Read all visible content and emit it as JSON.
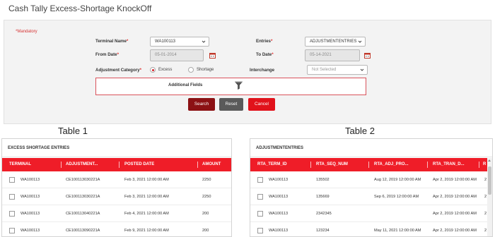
{
  "page": {
    "title": "Cash Tally Excess-Shortage KnockOff"
  },
  "form": {
    "mandatory": "*Mandatory",
    "terminal_name": {
      "label": "Terminal Name",
      "value": "WA100113"
    },
    "entries": {
      "label": "Entries",
      "value": "ADJUSTMENTENTRIES"
    },
    "from_date": {
      "label": "From Date",
      "value": "05-01-2014"
    },
    "to_date": {
      "label": "To Date",
      "value": "05-14-2021"
    },
    "adjustment_category": {
      "label": "Adjustment Category",
      "options": [
        "Excess",
        "Shortage"
      ],
      "selected": "Excess"
    },
    "interchange": {
      "label": "Interchange",
      "value": "Not Selected"
    },
    "additional_fields": "Additional Fields",
    "buttons": {
      "search": "Search",
      "reset": "Reset",
      "cancel": "Cancel"
    }
  },
  "captions": {
    "table1": "Table 1",
    "table2": "Table 2"
  },
  "table1": {
    "title": "EXCESS SHORTAGE ENTRIES",
    "columns": [
      "TERMINAL",
      "ADJUSTMENT...",
      "POSTED DATE",
      "AMOUNT"
    ],
    "rows": [
      [
        "WA100113",
        "CE100113030221A",
        "Feb 3, 2021 12:00:00 AM",
        "2250"
      ],
      [
        "WA100113",
        "CE100113030221A",
        "Feb 3, 2021 12:00:00 AM",
        "2250"
      ],
      [
        "WA100113",
        "CE100113040221A",
        "Feb 4, 2021 12:00:00 AM",
        "200"
      ],
      [
        "WA100113",
        "CE100113090221A",
        "Feb 9, 2021 12:00:00 AM",
        "200"
      ]
    ]
  },
  "table2": {
    "title": "ADJUSTMENTENTRIES",
    "columns": [
      "RTA_TERM_ID",
      "RTA_SEQ_NUM",
      "RTA_ADJ_PRO...",
      "RTA_TRAN_D...",
      "R"
    ],
    "rows": [
      [
        "WA100113",
        "135502",
        "Aug 12, 2019 12:00:00 AM",
        "Apr 2, 2019 12:00:00 AM",
        "2"
      ],
      [
        "WA100113",
        "135669",
        "Sep 6, 2019 12:00:00 AM",
        "Apr 2, 2019 12:00:00 AM",
        "2"
      ],
      [
        "WA100113",
        "2342345",
        "",
        "Apr 2, 2019 12:00:00 AM",
        "2"
      ],
      [
        "WA100113",
        "123234",
        "May 11, 2021 12:00:00 AM",
        "Apr 2, 2019 12:00:00 AM",
        "2"
      ]
    ]
  },
  "colors": {
    "accent": "#ef1d28",
    "search": "#8c1114",
    "reset": "#5a5a5a",
    "cancel": "#e1121b"
  }
}
